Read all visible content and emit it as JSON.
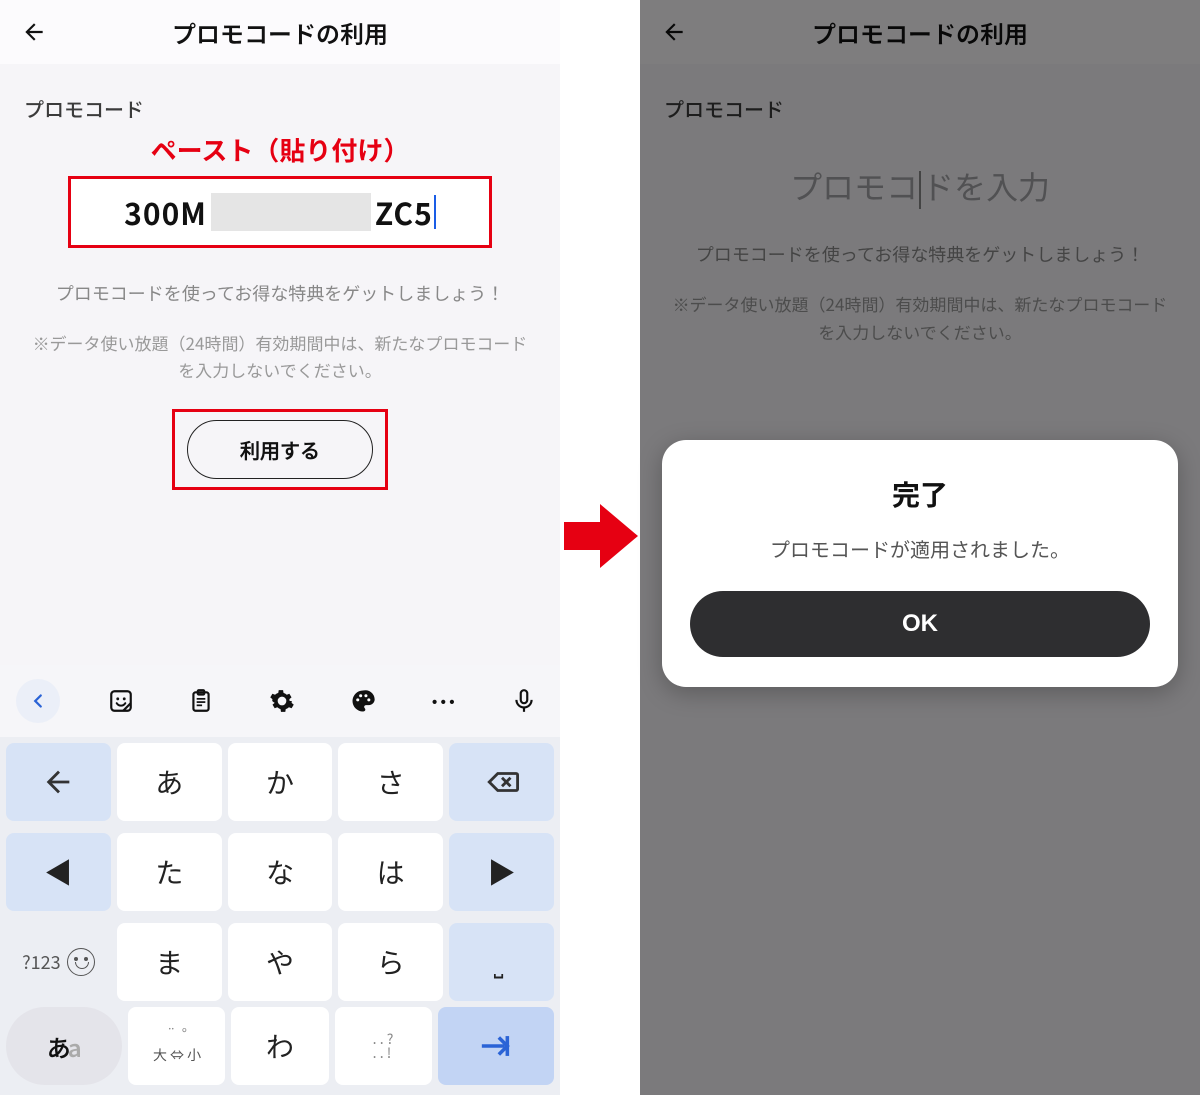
{
  "left": {
    "header": {
      "title": "プロモコードの利用"
    },
    "section_label": "プロモコード",
    "paste_annotation": "ペースト（貼り付け）",
    "code_prefix": "300M",
    "code_suffix": "ZC5",
    "tips": "プロモコードを使ってお得な特典をゲットしましょう！",
    "note": "※データ使い放題（24時間）有効期間中は、新たなプロモコードを入力しないでください。",
    "apply_label": "利用する",
    "keyboard": {
      "rows": [
        [
          "←",
          "あ",
          "か",
          "さ",
          "⌫"
        ],
        [
          "◀",
          "た",
          "な",
          "は",
          "▶"
        ],
        [
          "?123",
          "ま",
          "や",
          "ら",
          "␣"
        ],
        [
          "あa",
          "大⇔小",
          "わ",
          "、。?!",
          "⇥"
        ]
      ],
      "size_label": "大 ⇔ 小",
      "punct_main": "、。?!",
      "q123_label": "?123"
    }
  },
  "right": {
    "header": {
      "title": "プロモコードの利用"
    },
    "section_label": "プロモコード",
    "placeholder": "プロモコードを入力",
    "placeholder_pre": "プロモコ",
    "placeholder_post": "ドを入力",
    "tips": "プロモコードを使ってお得な特典をゲットしましょう！",
    "note": "※データ使い放題（24時間）有効期間中は、新たなプロモコードを入力しないでください。",
    "popup": {
      "title": "完了",
      "message": "プロモコードが適用されました。",
      "ok": "OK"
    }
  }
}
